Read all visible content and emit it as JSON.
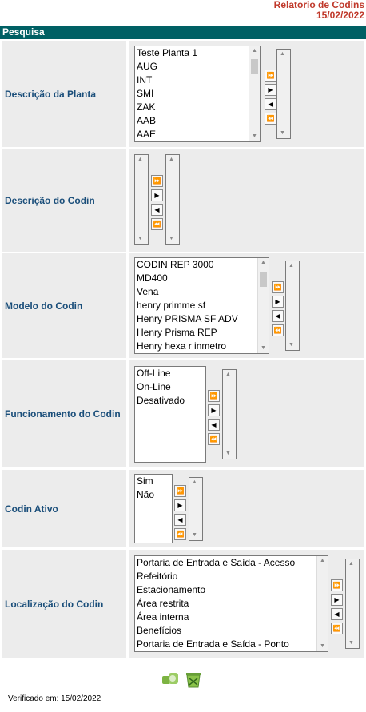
{
  "title": {
    "line1": "Relatorio de Codins",
    "line2": "15/02/2022"
  },
  "section": "Pesquisa",
  "rows": [
    {
      "label": "Descrição da Planta",
      "options": [
        "Teste Planta 1",
        "AUG",
        "INT",
        "SMI",
        "ZAK",
        "AAB",
        "AAE"
      ]
    },
    {
      "label": "Descrição do Codin",
      "options": []
    },
    {
      "label": "Modelo do Codin",
      "options": [
        "CODIN REP 3000",
        "MD400",
        "Vena",
        "henry primme sf",
        "Henry PRISMA SF ADV",
        "Henry Prisma REP",
        "Henry hexa r inmetro"
      ]
    },
    {
      "label": "Funcionamento do Codin",
      "options": [
        "Off-Line",
        "On-Line",
        "Desativado"
      ]
    },
    {
      "label": "Codin Ativo",
      "options": [
        "Sim",
        "Não"
      ]
    },
    {
      "label": "Localização do Codin",
      "options": [
        "Portaria de Entrada e Saída - Acesso",
        "Refeitório",
        "Estacionamento",
        "Área restrita",
        "Área interna",
        "Benefícios",
        "Portaria de Entrada e Saída - Ponto"
      ]
    }
  ],
  "buttons": {
    "add_all": "⏩",
    "add": "▶",
    "remove": "◀",
    "remove_all": "⏪"
  },
  "footer": {
    "verified": "Verificado em: 15/02/2022"
  },
  "icons": {
    "search": "search-icon",
    "clear": "trash-icon"
  }
}
